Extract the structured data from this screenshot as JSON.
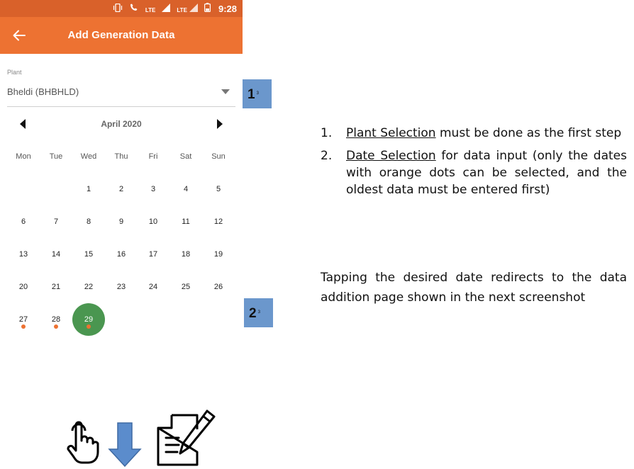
{
  "status_bar": {
    "lte1": "LTE",
    "lte2": "LTE",
    "time": "9:28"
  },
  "app_bar": {
    "title": "Add Generation Data"
  },
  "plant": {
    "label": "Plant",
    "value": "Bheldi (BHBHLD)"
  },
  "calendar": {
    "month": "April 2020",
    "weekdays": [
      "Mon",
      "Tue",
      "Wed",
      "Thu",
      "Fri",
      "Sat",
      "Sun"
    ],
    "weeks": [
      [
        "",
        "",
        "1",
        "2",
        "3",
        "4",
        "5"
      ],
      [
        "6",
        "7",
        "8",
        "9",
        "10",
        "11",
        "12"
      ],
      [
        "13",
        "14",
        "15",
        "16",
        "17",
        "18",
        "19"
      ],
      [
        "20",
        "21",
        "22",
        "23",
        "24",
        "25",
        "26"
      ],
      [
        "27",
        "28",
        "29",
        "",
        "",
        "",
        ""
      ]
    ],
    "selected_day": "29",
    "dotted_days": [
      "27",
      "28",
      "29"
    ]
  },
  "markers": [
    {
      "number": "1",
      "sup": "3"
    },
    {
      "number": "2",
      "sup": "3"
    }
  ],
  "instructions": {
    "items": [
      {
        "num": "1.",
        "link": "Plant Selection",
        "text": " must be done as the first step"
      },
      {
        "num": "2.",
        "link": "Date Selection",
        "text": " for data input (only the dates with orange dots can be selected, and the oldest data must be entered first)"
      }
    ],
    "note": "Tapping the desired date redirects to the data addition page shown in the next screenshot"
  },
  "icons": [
    "tap-hand-icon",
    "arrow-down-icon",
    "document-edit-icon"
  ],
  "colors": {
    "accent": "#ed7232",
    "status_bar": "#d9612a",
    "selected": "#4a9650",
    "marker": "#6b97cc"
  }
}
